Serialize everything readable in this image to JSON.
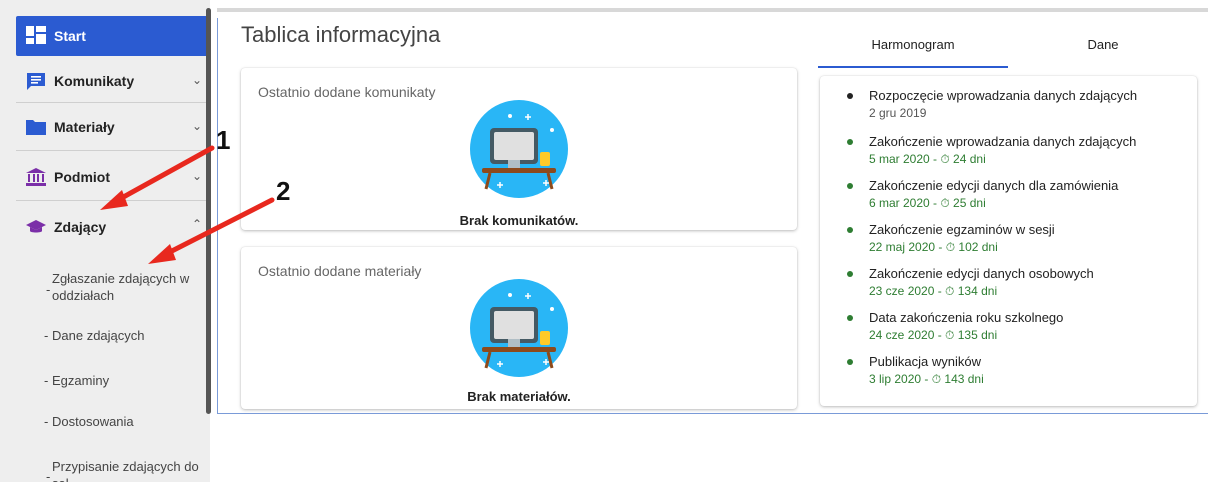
{
  "sidebar": {
    "items": [
      {
        "label": "Start",
        "icon": "dashboard-icon"
      },
      {
        "label": "Komunikaty",
        "icon": "message-icon"
      },
      {
        "label": "Materiały",
        "icon": "folder-icon"
      },
      {
        "label": "Podmiot",
        "icon": "institution-icon"
      },
      {
        "label": "Zdający",
        "icon": "graduation-cap-icon"
      }
    ],
    "subitems": [
      "Zgłaszanie zdających w oddziałach",
      "Dane zdających",
      "Egzaminy",
      "Dostosowania",
      "Przypisanie zdających do sal"
    ]
  },
  "main": {
    "title": "Tablica informacyjna",
    "cards": [
      {
        "title": "Ostatnio dodane komunikaty",
        "empty": "Brak komunikatów."
      },
      {
        "title": "Ostatnio dodane materiały",
        "empty": "Brak materiałów."
      }
    ]
  },
  "tabs": [
    "Harmonogram",
    "Dane"
  ],
  "timeline": [
    {
      "title": "Rozpoczęcie wprowadzania danych zdających",
      "date": "2 gru 2019"
    },
    {
      "title": "Zakończenie wprowadzania danych zdających",
      "date": "5 mar 2020 - ⏱ 24 dni"
    },
    {
      "title": "Zakończenie edycji danych dla zamówienia",
      "date": "6 mar 2020 - ⏱ 25 dni"
    },
    {
      "title": "Zakończenie egzaminów w sesji",
      "date": "22 maj 2020 - ⏱ 102 dni"
    },
    {
      "title": "Zakończenie edycji danych osobowych",
      "date": "23 cze 2020 - ⏱ 134 dni"
    },
    {
      "title": "Data zakończenia roku szkolnego",
      "date": "24 cze 2020 - ⏱ 135 dni"
    },
    {
      "title": "Publikacja wyników",
      "date": "3 lip 2020 - ⏱ 143 dni"
    }
  ],
  "annotations": [
    "1",
    "2"
  ],
  "colors": {
    "accent": "#2b5bd1",
    "status_green": "#2e7d32",
    "annotation_arrow": "#e8281e"
  }
}
